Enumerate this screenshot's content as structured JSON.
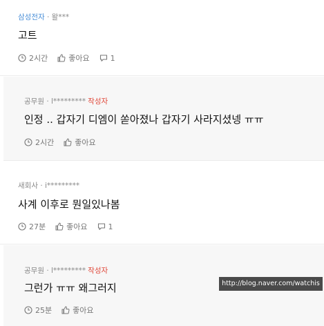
{
  "comments": [
    {
      "company": "삼성전자",
      "separator": " · ",
      "author": "왈***",
      "author_tag": "",
      "text": "고트",
      "time": "2시간",
      "like_label": "좋아요",
      "reply_count": "1"
    },
    {
      "company": "공무원",
      "separator": " · ",
      "author": "l*********",
      "author_tag": "작성자",
      "text": "인정 .. 갑자기 디엠이 쏟아졌나 갑자기 사라지셨넹 ㅠㅠ",
      "time": "2시간",
      "like_label": "좋아요",
      "reply_count": ""
    },
    {
      "company": "새회사",
      "separator": " · ",
      "author": "i*********",
      "author_tag": "",
      "text": "사계 이후로 뭔일있나봄",
      "time": "27분",
      "like_label": "좋아요",
      "reply_count": "1"
    },
    {
      "company": "공무원",
      "separator": " · ",
      "author": "l*********",
      "author_tag": "작성자",
      "text": "그런가 ㅠㅠ 왜그러지",
      "time": "25분",
      "like_label": "좋아요",
      "reply_count": ""
    }
  ],
  "watermark": "http://blog.naver.com/watchis",
  "colors": {
    "company_link": "#4a8fd8",
    "author_tag": "#e0483a",
    "reply_background": "#f7f7f7",
    "watermark_background": "#4a4a4a"
  },
  "icons": [
    "clock-icon",
    "thumbs-up-icon",
    "comment-icon"
  ]
}
